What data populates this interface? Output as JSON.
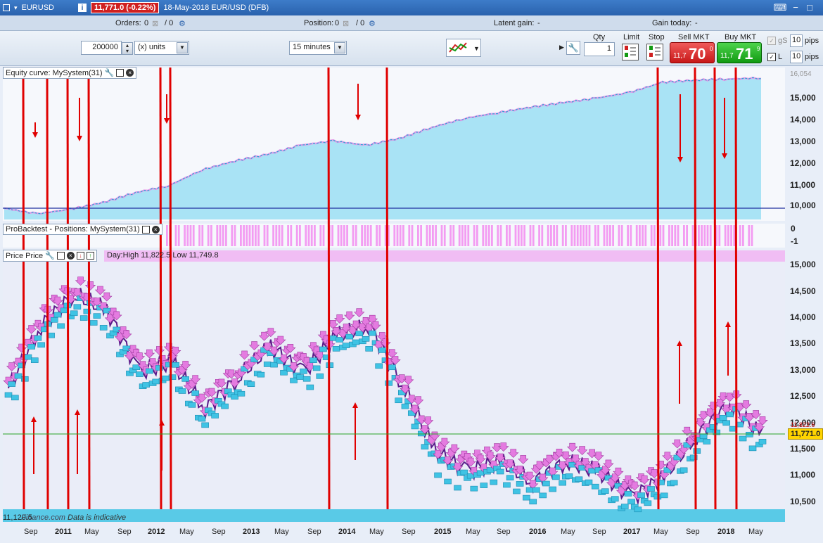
{
  "titlebar": {
    "instrument": "EURUSD",
    "price_badge": "11,771.0 (-0.22%)",
    "description": "18-May-2018 EUR/USD (DFB)"
  },
  "status": {
    "orders_label": "Orders:",
    "orders_value": "0",
    "orders_value2": "/ 0",
    "position_label": "Position:",
    "position_value": "0",
    "position_value2": "/ 0",
    "latent_label": "Latent gain:",
    "latent_value": "-",
    "gain_label": "Gain today:",
    "gain_value": "-"
  },
  "toolbar": {
    "quantity": "200000",
    "unit": "(x) units",
    "timeframe": "15 minutes",
    "qty_label": "Qty",
    "qty_value": "1",
    "limit_label": "Limit",
    "stop_label": "Stop",
    "sell_label": "Sell MKT",
    "sell_small": "11,7",
    "sell_big": "70",
    "sell_sup": "0",
    "buy_label": "Buy MKT",
    "buy_small": "11,7",
    "buy_big": "71",
    "buy_sup": "9",
    "gs_label": "gS",
    "gs_pips": "10",
    "l_label": "L",
    "l_pips": "10",
    "pips_label": "pips"
  },
  "panels": {
    "equity_label": "Equity curve: MySystem(31)",
    "positions_label": "ProBacktest - Positions: MySystem(31)",
    "price_label": "Price Price",
    "day_info": "Day:High 11,822.5 Low 11,749.8"
  },
  "equity_axis": [
    "16,054",
    "15,000",
    "14,000",
    "13,000",
    "12,000",
    "11,000",
    "10,000"
  ],
  "positions_axis": [
    "0",
    "-1"
  ],
  "price_axis": [
    "15,000",
    "14,500",
    "14,000",
    "13,500",
    "13,000",
    "12,500",
    "12,000",
    "11,500",
    "11,000",
    "10,500"
  ],
  "current_price": "11,771.0",
  "price_above": "11,822.6",
  "footer_note": "Data is indicative",
  "footer_left": "11,120.5",
  "watermark": "Finance.com",
  "x_labels": [
    {
      "t": "Sep",
      "y": false
    },
    {
      "t": "2011",
      "y": true
    },
    {
      "t": "May",
      "y": false
    },
    {
      "t": "Sep",
      "y": false
    },
    {
      "t": "2012",
      "y": true
    },
    {
      "t": "May",
      "y": false
    },
    {
      "t": "Sep",
      "y": false
    },
    {
      "t": "2013",
      "y": true
    },
    {
      "t": "May",
      "y": false
    },
    {
      "t": "Sep",
      "y": false
    },
    {
      "t": "2014",
      "y": true
    },
    {
      "t": "May",
      "y": false
    },
    {
      "t": "Sep",
      "y": false
    },
    {
      "t": "2015",
      "y": true
    },
    {
      "t": "May",
      "y": false
    },
    {
      "t": "Sep",
      "y": false
    },
    {
      "t": "2016",
      "y": true
    },
    {
      "t": "May",
      "y": false
    },
    {
      "t": "Sep",
      "y": false
    },
    {
      "t": "2017",
      "y": true
    },
    {
      "t": "May",
      "y": false
    },
    {
      "t": "Sep",
      "y": false
    },
    {
      "t": "2018",
      "y": true
    },
    {
      "t": "May",
      "y": false
    }
  ],
  "colors": {
    "equity_fill": "#a9e3f5",
    "equity_line": "#2aa6d6",
    "equity_highlight": "#e79be8",
    "positions_fill": "#f39cf2",
    "sell_marker": "#e47be0",
    "buy_marker": "#3fc3e4",
    "annotation": "#e00000",
    "baseline": "#2030a0",
    "price_line": "#29a329"
  },
  "chart_data": [
    {
      "type": "area",
      "title": "Equity curve: MySystem(31)",
      "x": [
        "2010-08",
        "2010-12",
        "2011-04",
        "2011-08",
        "2012-01",
        "2012-04",
        "2012-08",
        "2013-01",
        "2013-05",
        "2013-09",
        "2014-01",
        "2014-05",
        "2014-09",
        "2015-01",
        "2015-05",
        "2015-09",
        "2016-01",
        "2016-05",
        "2016-09",
        "2017-01",
        "2017-05",
        "2017-09",
        "2018-01",
        "2018-05"
      ],
      "values": [
        10000,
        9750,
        9950,
        10250,
        10700,
        11000,
        11700,
        12100,
        12400,
        12800,
        13000,
        12800,
        13100,
        13600,
        14000,
        14250,
        14500,
        14700,
        14900,
        15150,
        15600,
        15700,
        15750,
        15800
      ],
      "ylim": [
        9500,
        16200
      ]
    },
    {
      "type": "line",
      "title": "Price",
      "x": [
        "2010-07",
        "2010-11",
        "2011-04",
        "2011-08",
        "2012-01",
        "2012-04",
        "2012-07",
        "2012-10",
        "2013-02",
        "2013-07",
        "2014-01",
        "2014-05",
        "2014-09",
        "2015-01",
        "2015-05",
        "2015-09",
        "2016-01",
        "2016-05",
        "2016-09",
        "2017-01",
        "2017-05",
        "2017-09",
        "2018-01",
        "2018-05"
      ],
      "values": [
        12700,
        13900,
        14500,
        14200,
        13000,
        13200,
        12300,
        12900,
        13500,
        13000,
        13700,
        13900,
        12800,
        11500,
        11100,
        11300,
        10900,
        11300,
        11100,
        10600,
        11000,
        11800,
        12400,
        11771
      ],
      "ylim": [
        10300,
        15100
      ]
    }
  ]
}
